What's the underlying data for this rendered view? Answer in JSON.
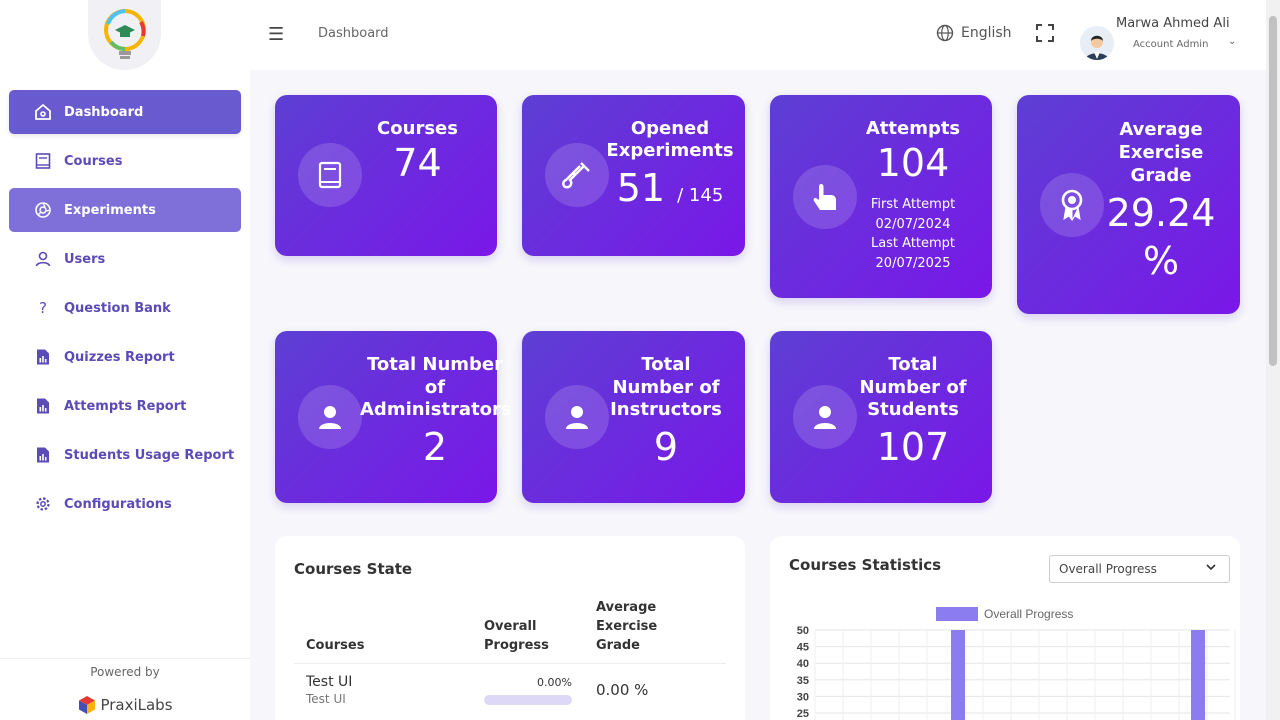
{
  "sidebar": {
    "items": [
      {
        "label": "Dashboard",
        "icon": "home-icon"
      },
      {
        "label": "Courses",
        "icon": "book-icon"
      },
      {
        "label": "Experiments",
        "icon": "aperture-icon"
      },
      {
        "label": "Users",
        "icon": "user-icon"
      },
      {
        "label": "Question Bank",
        "icon": "question-icon"
      },
      {
        "label": "Quizzes Report",
        "icon": "report-icon"
      },
      {
        "label": "Attempts Report",
        "icon": "report-icon"
      },
      {
        "label": "Students Usage Report",
        "icon": "report-icon"
      },
      {
        "label": "Configurations",
        "icon": "gear-icon"
      }
    ],
    "powered_by": "Powered by",
    "brand": "PraxiLabs"
  },
  "header": {
    "breadcrumb": "Dashboard",
    "language": "English",
    "user_name": "Marwa Ahmed Ali",
    "user_role": "Account Admin"
  },
  "cards": {
    "courses": {
      "title": "Courses",
      "value": "74"
    },
    "experiments": {
      "title1": "Opened",
      "title2": "Experiments",
      "value": "51",
      "total": "/ 145"
    },
    "attempts": {
      "title": "Attempts",
      "value": "104",
      "first_label": "First Attempt",
      "first_date": "02/07/2024",
      "last_label": "Last Attempt",
      "last_date": "20/07/2025"
    },
    "grade": {
      "title1": "Average",
      "title2": "Exercise",
      "title3": "Grade",
      "value": "29.24",
      "unit": "%"
    },
    "admins": {
      "title1": "Total Number",
      "title2": "of",
      "title3": "Administrators",
      "value": "2"
    },
    "instructors": {
      "title1": "Total",
      "title2": "Number of",
      "title3": "Instructors",
      "value": "9"
    },
    "students": {
      "title1": "Total",
      "title2": "Number of",
      "title3": "Students",
      "value": "107"
    }
  },
  "courses_state": {
    "title": "Courses State",
    "headers": {
      "course": "Courses",
      "progress1": "Overall",
      "progress2": "Progress",
      "grade1": "Average Exercise",
      "grade2": "Grade"
    },
    "rows": [
      {
        "name": "Test UI",
        "subtitle": "Test UI",
        "progress": "0.00%",
        "progress_fraction": 0.0,
        "grade": "0.00 %"
      }
    ]
  },
  "courses_statistics": {
    "title": "Courses Statistics",
    "select_value": "Overall Progress"
  },
  "chart_data": {
    "type": "bar",
    "series": [
      {
        "name": "Overall Progress",
        "color": "#8b7cf0"
      }
    ],
    "y_ticks": [
      "50",
      "45",
      "40",
      "35",
      "30",
      "25"
    ],
    "bar_values": [
      50,
      50
    ],
    "ylim": [
      25,
      50
    ],
    "grid": true,
    "legend": "top"
  }
}
